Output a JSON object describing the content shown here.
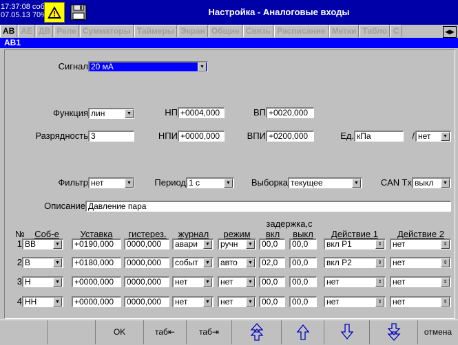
{
  "status": {
    "time": "17:37:08",
    "mode": "собт",
    "date": "07.05.13",
    "battery": "70%"
  },
  "title": "Настройка - Аналоговые входы",
  "tabs": [
    "АВ",
    "АЕ",
    "ДВ",
    "Реле",
    "Сумматоры",
    "Таймеры",
    "Экран",
    "Общие",
    "Связь",
    "Расписание",
    "Метки",
    "Табло",
    "С"
  ],
  "section": "АВ1",
  "form": {
    "signal": {
      "label": "Сигнал",
      "value": "20 мА"
    },
    "function": {
      "label": "Функция",
      "value": "лин"
    },
    "np": {
      "label": "НП",
      "value": "+0004,000"
    },
    "vp": {
      "label": "ВП",
      "value": "+0020,000"
    },
    "digits": {
      "label": "Разрядность",
      "value": "3"
    },
    "npi": {
      "label": "НПИ",
      "value": "+0000,000"
    },
    "vpi": {
      "label": "ВПИ",
      "value": "+0200,000"
    },
    "unit": {
      "label": "Ед.",
      "value": "кПа"
    },
    "unit2": {
      "label": "/",
      "value": "нет"
    },
    "filter": {
      "label": "Фильтр",
      "value": "нет"
    },
    "period": {
      "label": "Период",
      "value": "1 с"
    },
    "sample": {
      "label": "Выборка",
      "value": "текущее"
    },
    "cantx": {
      "label": "CAN Tx",
      "value": "выкл"
    },
    "description": {
      "label": "Описание",
      "value": "Давление пара"
    }
  },
  "events": {
    "headers": {
      "no": "№",
      "event": "Соб-е",
      "setpoint": "Уставка",
      "hyst": "гистерез.",
      "journal": "журнал",
      "mode": "режим",
      "delay": "задержка,с",
      "on": "вкл",
      "off": "выкл",
      "action1": "Действие 1",
      "action2": "Действие 2"
    },
    "rows": [
      {
        "n": "1",
        "event": "ВВ",
        "setpoint": "+0190,000",
        "hyst": "0000,000",
        "journal": "авари",
        "mode": "ручн",
        "on": "00,0",
        "off": "00,0",
        "action1": "вкл Р1",
        "action2": "нет"
      },
      {
        "n": "2",
        "event": "В",
        "setpoint": "+0180,000",
        "hyst": "0000,000",
        "journal": "событ",
        "mode": "авто",
        "on": "02,0",
        "off": "00,0",
        "action1": "вкл Р2",
        "action2": "нет"
      },
      {
        "n": "3",
        "event": "Н",
        "setpoint": "+0000,000",
        "hyst": "0000,000",
        "journal": "нет",
        "mode": "нет",
        "on": "00,0",
        "off": "00,0",
        "action1": "нет",
        "action2": "нет"
      },
      {
        "n": "4",
        "event": "НН",
        "setpoint": "+0000,000",
        "hyst": "0000,000",
        "journal": "нет",
        "mode": "нет",
        "on": "00,0",
        "off": "00,0",
        "action1": "нет",
        "action2": "нет"
      }
    ]
  },
  "buttons": {
    "ok": "OK",
    "tab_back": "таб⇤",
    "tab_fwd": "таб⇥"
  },
  "colors": {
    "titlebar": "#0000a8",
    "selection": "#0000ff",
    "background": "#c0c0c0"
  }
}
